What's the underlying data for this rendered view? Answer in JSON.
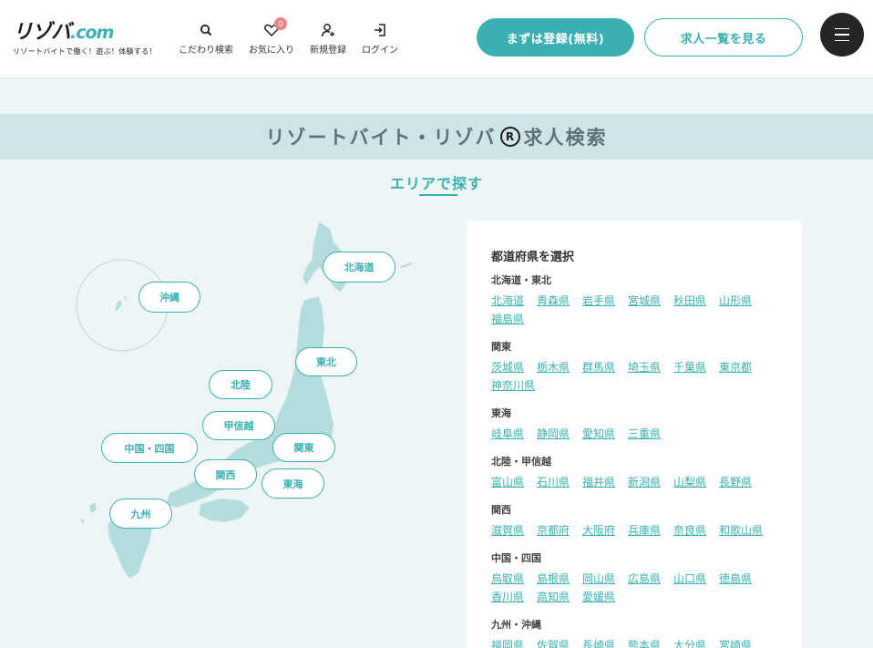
{
  "header": {
    "logo_text": "リゾバ",
    "logo_suffix": ".com",
    "logo_tagline": "リゾートバイトで働く！遊ぶ！体験する！",
    "nav": [
      {
        "label": "こだわり検索",
        "icon": "search-icon"
      },
      {
        "label": "お気に入り",
        "icon": "heart-icon",
        "badge": "0"
      },
      {
        "label": "新規登録",
        "icon": "user-add-icon"
      },
      {
        "label": "ログイン",
        "icon": "login-icon"
      }
    ],
    "register_button": "まずは登録(無料)",
    "job_list_button": "求人一覧を見る",
    "menu_icon": "hamburger-icon"
  },
  "page": {
    "title_prefix": "リゾートバイト・リゾバ",
    "title_mark": "R",
    "title_suffix": "求人検索",
    "area_heading": "エリアで探す"
  },
  "map": {
    "regions": [
      "北海道",
      "沖縄",
      "東北",
      "北陸",
      "甲信越",
      "関東",
      "中国・四国",
      "関西",
      "東海",
      "九州"
    ]
  },
  "prefecture_panel": {
    "heading": "都道府県を選択",
    "groups": [
      {
        "name": "北海道・東北",
        "prefs": [
          "北海道",
          "青森県",
          "岩手県",
          "宮城県",
          "秋田県",
          "山形県",
          "福島県"
        ]
      },
      {
        "name": "関東",
        "prefs": [
          "茨城県",
          "栃木県",
          "群馬県",
          "埼玉県",
          "千葉県",
          "東京都",
          "神奈川県"
        ]
      },
      {
        "name": "東海",
        "prefs": [
          "岐阜県",
          "静岡県",
          "愛知県",
          "三重県"
        ]
      },
      {
        "name": "北陸・甲信越",
        "prefs": [
          "富山県",
          "石川県",
          "福井県",
          "新潟県",
          "山梨県",
          "長野県"
        ]
      },
      {
        "name": "関西",
        "prefs": [
          "滋賀県",
          "京都府",
          "大阪府",
          "兵庫県",
          "奈良県",
          "和歌山県"
        ]
      },
      {
        "name": "中国・四国",
        "prefs": [
          "鳥取県",
          "島根県",
          "岡山県",
          "広島県",
          "山口県",
          "徳島県",
          "香川県",
          "高知県",
          "愛媛県"
        ]
      },
      {
        "name": "九州・沖縄",
        "prefs": [
          "福岡県",
          "佐賀県",
          "長崎県",
          "熊本県",
          "大分県",
          "宮崎県"
        ]
      }
    ]
  },
  "colors": {
    "accent": "#3bb0b2",
    "title_band": "#cde5e7",
    "background": "#eef5f5",
    "badge": "#e88686"
  }
}
